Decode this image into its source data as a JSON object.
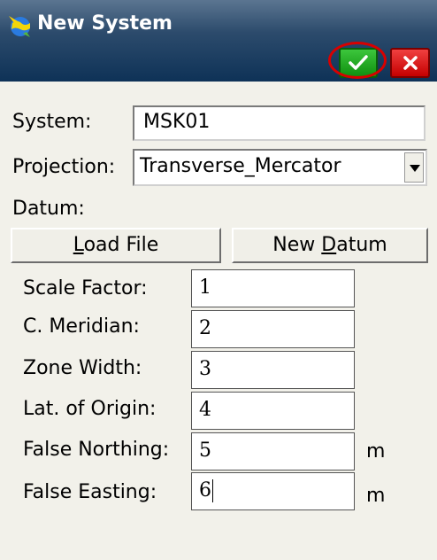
{
  "window": {
    "title": "New System"
  },
  "actions": {
    "ok_icon": "checkmark-icon",
    "cancel_icon": "close-icon"
  },
  "form": {
    "system_label": "System:",
    "system_value": "MSK01",
    "projection_label": "Projection:",
    "projection_value": "Transverse_Mercator",
    "datum_label": "Datum:",
    "load_file_pre": "",
    "load_file_u": "L",
    "load_file_post": "oad File",
    "new_datum_pre": "New ",
    "new_datum_u": "D",
    "new_datum_post": "atum"
  },
  "params": [
    {
      "label": "Scale Factor:",
      "value": "1",
      "unit": ""
    },
    {
      "label": "C. Meridian:",
      "value": "2",
      "unit": ""
    },
    {
      "label": "Zone Width:",
      "value": "3",
      "unit": ""
    },
    {
      "label": "Lat. of Origin:",
      "value": "4",
      "unit": ""
    },
    {
      "label": "False Northing:",
      "value": "5",
      "unit": "m"
    },
    {
      "label": "False Easting:",
      "value": "6",
      "unit": "m"
    }
  ],
  "colors": {
    "titlebar": "#0e3257",
    "ok": "#1aa81a",
    "cancel": "#d40000",
    "highlight": "#d80000",
    "background": "#f2f1ea"
  }
}
